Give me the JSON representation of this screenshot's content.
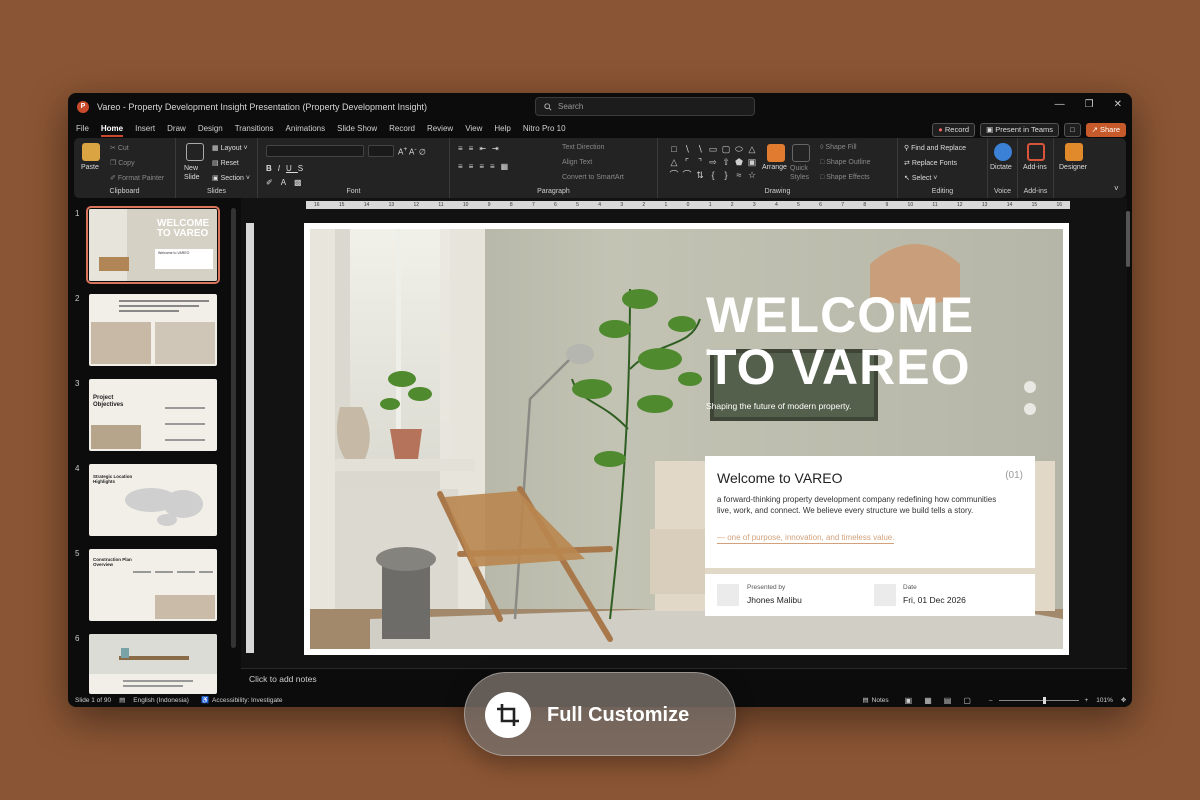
{
  "window": {
    "title": "Vareo - Property Development Insight Presentation (Property Development Insight)",
    "search_placeholder": "Search",
    "app_letter": "P"
  },
  "tabs": [
    "File",
    "Home",
    "Insert",
    "Draw",
    "Design",
    "Transitions",
    "Animations",
    "Slide Show",
    "Record",
    "Review",
    "View",
    "Help",
    "Nitro Pro 10"
  ],
  "active_tab": "Home",
  "top_buttons": {
    "record": "Record",
    "teams": "Present in Teams",
    "share": "Share"
  },
  "ribbon": {
    "clipboard": {
      "label": "Clipboard",
      "paste": "Paste",
      "cut": "Cut",
      "copy": "Copy",
      "format_painter": "Format Painter"
    },
    "slides": {
      "label": "Slides",
      "new_slide": "New Slide",
      "layout": "Layout",
      "reset": "Reset",
      "section": "Section"
    },
    "font": {
      "label": "Font"
    },
    "paragraph": {
      "label": "Paragraph",
      "text_direction": "Text Direction",
      "align_text": "Align Text",
      "convert_smartart": "Convert to SmartArt"
    },
    "drawing": {
      "label": "Drawing",
      "arrange": "Arrange",
      "quick_styles": "Quick Styles",
      "shape_fill": "Shape Fill",
      "shape_outline": "Shape Outline",
      "shape_effects": "Shape Effects"
    },
    "editing": {
      "label": "Editing",
      "find_replace": "Find and Replace",
      "replace_fonts": "Replace Fonts",
      "select": "Select"
    },
    "voice": {
      "label": "Voice",
      "dictate": "Dictate"
    },
    "addins": {
      "label": "Add-ins",
      "addins": "Add-ins"
    },
    "designer": {
      "designer": "Designer"
    }
  },
  "thumbnails": [
    {
      "num": "1",
      "t1": "WELCOME",
      "t2": "TO VAREO",
      "t3": "Welcome to VAREO"
    },
    {
      "num": "2"
    },
    {
      "num": "3",
      "t1": "Project",
      "t2": "Objectives"
    },
    {
      "num": "4",
      "t1": "Strategic Location",
      "t2": "Highlights"
    },
    {
      "num": "5",
      "t1": "Construction Plan",
      "t2": "Overview"
    },
    {
      "num": "6"
    }
  ],
  "slide": {
    "heading1": "WELCOME",
    "heading2": "TO VAREO",
    "tagline": "Shaping the future of modern property.",
    "card_title": "Welcome to VAREO",
    "card_num": "(01)",
    "card_body": "a forward-thinking property development company redefining how communities live, work, and connect. We believe every structure we build tells a story.",
    "card_quote": "— one of purpose, innovation, and timeless value.",
    "presented_label": "Presented by",
    "presenter": "Jhones Malibu",
    "date_label": "Date",
    "date": "Fri, 01 Dec 2026"
  },
  "notes_placeholder": "Click to add notes",
  "status": {
    "slide": "Slide 1 of 90",
    "language": "English (Indonesia)",
    "accessibility": "Accessibility: Investigate",
    "notes": "Notes",
    "zoom": "101%"
  },
  "ruler": [
    "16",
    "15",
    "14",
    "13",
    "12",
    "11",
    "10",
    "9",
    "8",
    "7",
    "6",
    "5",
    "4",
    "3",
    "2",
    "1",
    "0",
    "1",
    "2",
    "3",
    "4",
    "5",
    "6",
    "7",
    "8",
    "9",
    "10",
    "11",
    "12",
    "13",
    "14",
    "15",
    "16"
  ],
  "overlay": {
    "label": "Full Customize"
  },
  "colors": {
    "accent": "#c94a2a",
    "background": "#8a5534",
    "quote": "#d3a27c"
  }
}
